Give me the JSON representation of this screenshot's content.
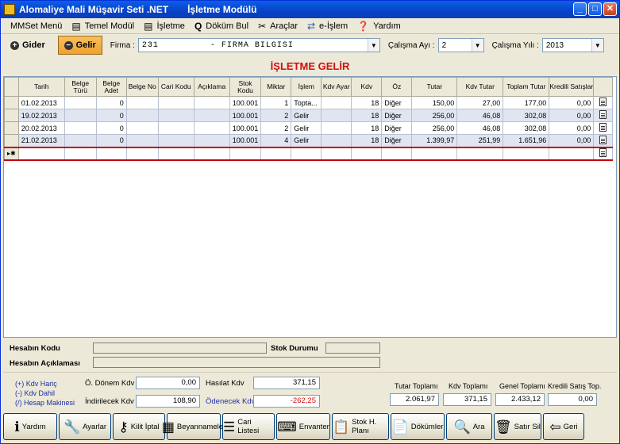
{
  "window": {
    "title": "Alomaliye Mali Müşavir Seti .NET",
    "module": "İşletme Modülü",
    "minimize": "_",
    "maximize": "□",
    "close": "✕"
  },
  "menu": [
    {
      "label": "MMSet Menü",
      "icon": "mmset-icon"
    },
    {
      "label": "Temel Modül",
      "icon": "module-icon"
    },
    {
      "label": "İşletme",
      "icon": "business-icon"
    },
    {
      "label": "Döküm Bul",
      "icon": "search-icon"
    },
    {
      "label": "Araçlar",
      "icon": "tools-icon"
    },
    {
      "label": "e-İşlem",
      "icon": "e-process-icon"
    },
    {
      "label": "Yardım",
      "icon": "help-icon"
    }
  ],
  "toolbar": {
    "gider": "Gider",
    "gelir": "Gelir",
    "firma_label": "Firma :",
    "firma_code": "231",
    "firma_name": "- FİRMA BİLGİSİ",
    "ay_label": "Çalışma Ayı :",
    "ay_value": "2",
    "yil_label": "Çalışma Yılı :",
    "yil_value": "2013"
  },
  "heading": "İŞLETME GELİR",
  "grid": {
    "columns": [
      "Tarih",
      "Belge Türü",
      "Belge Adet",
      "Belge No",
      "Cari Kodu",
      "Açıklama",
      "Stok Kodu",
      "Miktar",
      "İşlem",
      "Kdv Ayar",
      "Kdv",
      "Öz",
      "Tutar",
      "Kdv Tutar",
      "Toplam Tutar",
      "Kredili Satışlar"
    ],
    "rows": [
      [
        "01.02.2013",
        "",
        "0",
        "",
        "",
        "",
        "100.001",
        "1",
        "Topta...",
        "",
        "18",
        "Diğer",
        "150,00",
        "27,00",
        "177,00",
        "0,00"
      ],
      [
        "19.02.2013",
        "",
        "0",
        "",
        "",
        "",
        "100.001",
        "2",
        "Gelir",
        "",
        "18",
        "Diğer",
        "256,00",
        "46,08",
        "302,08",
        "0,00"
      ],
      [
        "20.02.2013",
        "",
        "0",
        "",
        "",
        "",
        "100.001",
        "2",
        "Gelir",
        "",
        "18",
        "Diğer",
        "256,00",
        "46,08",
        "302,08",
        "0,00"
      ],
      [
        "21.02.2013",
        "",
        "0",
        "",
        "",
        "",
        "100.001",
        "4",
        "Gelir",
        "",
        "18",
        "Diğer",
        "1.399,97",
        "251,99",
        "1.651,96",
        "0,00"
      ]
    ],
    "new_row_marker": "▸✱"
  },
  "hesap": {
    "kod_label": "Hesabın Kodu",
    "aciklama_label": "Hesabın Açıklaması",
    "stok_label": "Stok Durumu"
  },
  "kdv": {
    "haric": "(+) Kdv Hariç",
    "dahil": "(-) Kdv Dahil",
    "makine": "(/) Hesap Makinesi",
    "onceki_label": "Ö. Dönem Kdv",
    "onceki_value": "0,00",
    "indirilecek_label": "İndirilecek Kdv",
    "indirilecek_value": "108,90",
    "hasilat_label": "Hasılat Kdv",
    "hasilat_value": "371,15",
    "odenecek_label": "Ödenecek Kdv",
    "odenecek_value": "-262,25",
    "tutar_label": "Tutar Toplamı",
    "tutar_value": "2.061,97",
    "kdvt_label": "Kdv Toplamı",
    "kdvt_value": "371,15",
    "genel_label": "Genel Toplamı",
    "genel_value": "2.433,12",
    "kredili_label": "Kredili Satış Top.",
    "kredili_value": "0,00"
  },
  "buttons": [
    {
      "label": "Yardım",
      "icon": "info-icon",
      "glyph": "ℹ"
    },
    {
      "label": "Ayarlar",
      "icon": "wrench-icon",
      "glyph": "🔧"
    },
    {
      "label": "Kilit İptal",
      "icon": "key-icon",
      "glyph": "⚷"
    },
    {
      "label": "Beyannameler",
      "icon": "calendar-icon",
      "glyph": "▦"
    },
    {
      "label": "Cari Listesi",
      "icon": "list-icon",
      "glyph": "☰"
    },
    {
      "label": "Envanter",
      "icon": "keyboard-icon",
      "glyph": "⌨"
    },
    {
      "label": "Stok H. Planı",
      "icon": "clipboard-icon",
      "glyph": "📋"
    },
    {
      "label": "Dökümler",
      "icon": "document-icon",
      "glyph": "📄"
    },
    {
      "label": "Ara",
      "icon": "search-icon",
      "glyph": "🔍"
    },
    {
      "label": "Satır Sil",
      "icon": "trash-icon",
      "glyph": "🗑"
    },
    {
      "label": "Geri",
      "icon": "back-icon",
      "glyph": "⇦"
    }
  ]
}
